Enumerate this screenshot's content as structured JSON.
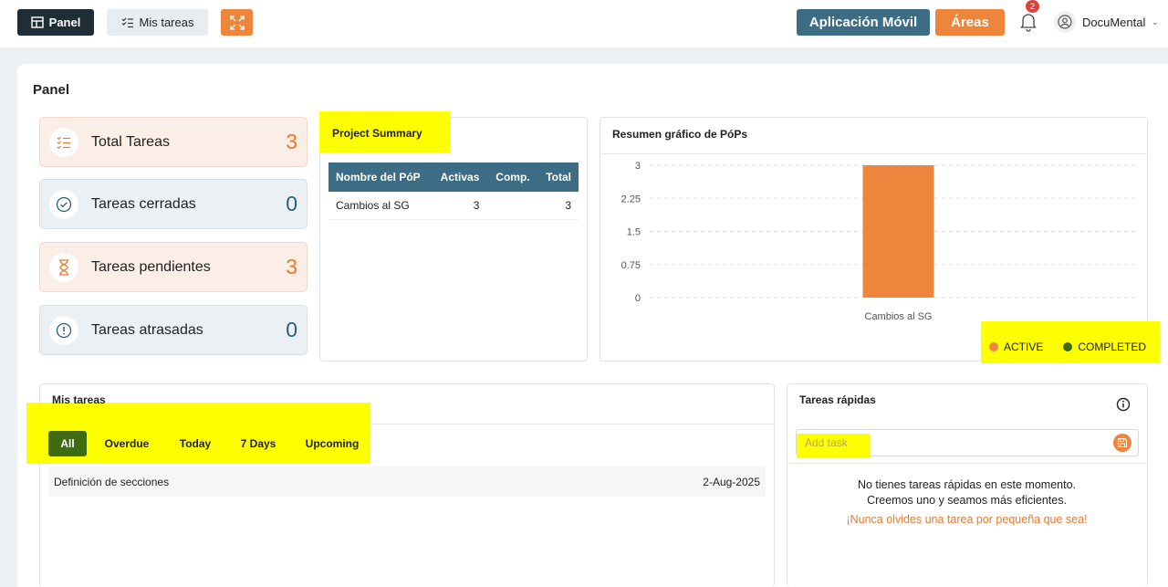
{
  "topbar": {
    "panel_label": "Panel",
    "tasks_label": "Mis tareas",
    "app_label": "Aplicación Móvil",
    "areas_label": "Áreas",
    "notif_count": "2",
    "user_name": "DocuMental"
  },
  "page_title": "Panel",
  "stats": [
    {
      "label": "Total Tareas",
      "value": "3",
      "icon": "task-list-icon",
      "color": "#e77a2d"
    },
    {
      "label": "Tareas cerradas",
      "value": "0",
      "icon": "check-circle-icon",
      "color": "#2a5f7f"
    },
    {
      "label": "Tareas pendientes",
      "value": "3",
      "icon": "hourglass-icon",
      "color": "#e77a2d"
    },
    {
      "label": "Tareas atrasadas",
      "value": "0",
      "icon": "alert-circle-icon",
      "color": "#2a5f7f"
    }
  ],
  "project_summary": {
    "title": "Project Summary",
    "columns": [
      "Nombre del PóP",
      "Activas",
      "Comp.",
      "Total"
    ],
    "rows": [
      {
        "name": "Cambios al SG",
        "active": "3",
        "completed": "",
        "total": "3"
      }
    ]
  },
  "chart_card_title": "Resumen gráfico de PóPs",
  "chart_data": {
    "type": "bar",
    "categories": [
      "Cambios al SG"
    ],
    "series": [
      {
        "name": "ACTIVE",
        "values": [
          3
        ],
        "color": "#ee853c"
      },
      {
        "name": "COMPLETED",
        "values": [
          0
        ],
        "color": "#3f6b12"
      }
    ],
    "ylim": [
      0,
      3
    ],
    "yticks": [
      "0",
      "0.75",
      "1.5",
      "2.25",
      "3"
    ],
    "grid": true,
    "legend": "bottom-right"
  },
  "my_tasks": {
    "title": "Mis tareas",
    "tabs": [
      "All",
      "Overdue",
      "Today",
      "7 Days",
      "Upcoming"
    ],
    "active_tab": "All",
    "items": [
      {
        "name": "Definición de secciones",
        "date": "2-Aug-2025"
      }
    ]
  },
  "quick_tasks": {
    "title": "Tareas rápidas",
    "placeholder": "Add task",
    "empty_line1": "No tienes tareas rápidas en este momento.",
    "empty_line2": "Creemos uno y seamos más eficientes.",
    "hint": "¡Nunca olvides una tarea por pequeña que sea!"
  },
  "colors": {
    "accent": "#ee853c",
    "dark": "#1f2d36",
    "teal": "#3d6d85",
    "green": "#3f6b12",
    "highlight": "#ffff00"
  }
}
